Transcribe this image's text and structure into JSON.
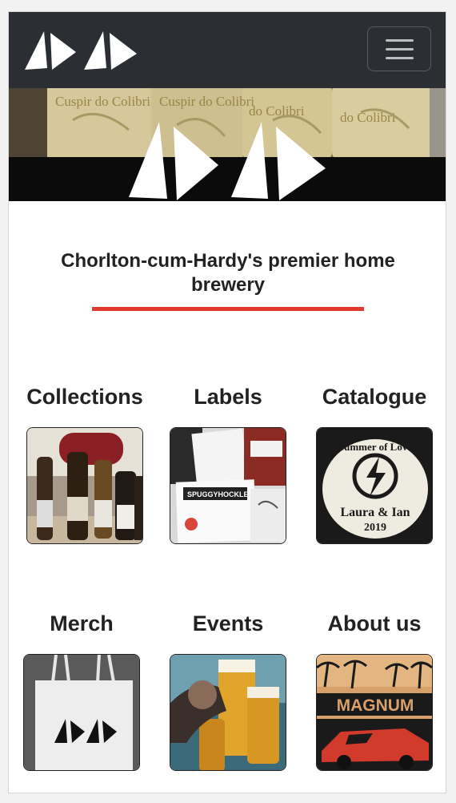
{
  "nav": {
    "brand_logo": "abab-logo-icon",
    "toggle_icon": "hamburger-menu-icon"
  },
  "hero": {
    "image": "beer-bottles-photo",
    "bottle_labels": [
      "Cuspir do Colibri",
      "Cuspir do Colibri",
      "do Colibri",
      "do Colibri"
    ]
  },
  "tagline": "Chorlton-cum-Hardy's premier home brewery",
  "colors": {
    "navbar": "#2b2f34",
    "accent": "#e33a2e",
    "text": "#222222"
  },
  "tiles": [
    {
      "title": "Collections",
      "image": "beer-bottles-icon"
    },
    {
      "title": "Labels",
      "image": "labels-collage-icon"
    },
    {
      "title": "Catalogue",
      "image": "summer-of-love-icon",
      "image_text": [
        "Summer of Love",
        "Laura & Ian",
        "2019"
      ]
    },
    {
      "title": "Merch",
      "image": "tote-bag-icon"
    },
    {
      "title": "Events",
      "image": "beer-glasses-icon"
    },
    {
      "title": "About us",
      "image": "magnum-poster-icon",
      "image_text": [
        "MAGNUM"
      ]
    }
  ]
}
